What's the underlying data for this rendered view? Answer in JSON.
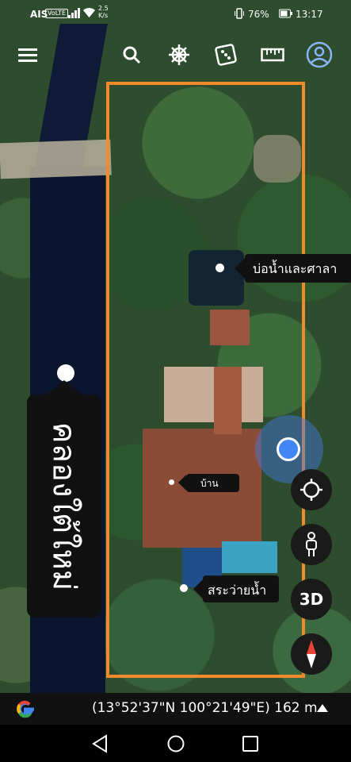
{
  "status_bar": {
    "carrier": "AIS",
    "network_badge": "VoLTE",
    "speed_value": "2.5",
    "speed_unit": "K/s",
    "battery": "76%",
    "time": "13:17"
  },
  "toolbar": {
    "icons": [
      "menu-icon",
      "search-icon",
      "ship-wheel-icon",
      "dice-icon",
      "ruler-icon",
      "account-icon"
    ]
  },
  "map": {
    "places": {
      "canal": "คลองใต้ใหม่",
      "pond": "บ่อน้ำและศาลา",
      "house": "บ้าน",
      "pool": "สระว่ายน้ำ"
    },
    "plot_outline_color": "#f08a2a"
  },
  "controls": {
    "three_d_label": "3D",
    "icons": [
      "locate-icon",
      "pegman-icon",
      "compass-icon"
    ]
  },
  "bottom_bar": {
    "coordinates": "(13°52'37\"N 100°21'49\"E) 162 m"
  },
  "colors": {
    "accent_blue": "#4285f4",
    "google_red": "#ea4335",
    "google_yellow": "#fbbc05",
    "google_green": "#34a853"
  }
}
